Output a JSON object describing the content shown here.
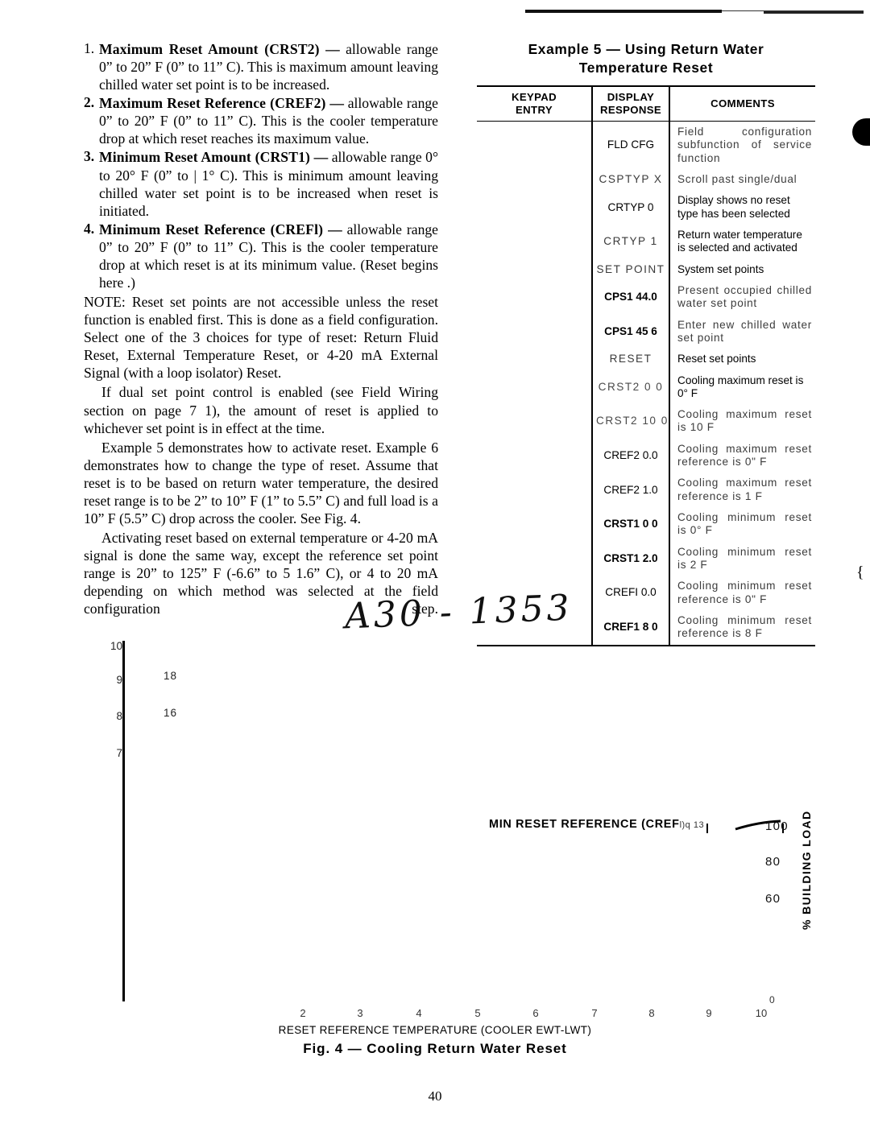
{
  "document": {
    "page_number": "40",
    "handwritten_note": "A30 - 1353"
  },
  "left_column": {
    "numbered_items": [
      {
        "number": "1.",
        "term": "Maximum Reset Amount (CRST2)",
        "dash": "—",
        "text": "allowable range 0” to 20” F (0” to 11” C). This is maximum amount leaving chilled water set point is to be increased."
      },
      {
        "number": "2.",
        "term": "Maximum Reset Reference (CREF2)",
        "dash": "—",
        "text": "allowable range 0” to 20” F (0” to 11” C). This is the cooler temperature drop at which reset reaches its maximum value."
      },
      {
        "number": "3.",
        "term": "Minimum Reset Amount (CRST1)",
        "dash": "—",
        "text": "allowable range 0° to 20° F (0” to | 1° C). This is minimum amount leaving chilled water set point is to be increased when reset is initiated."
      },
      {
        "number": "4.",
        "term": "Minimum Reset Reference (CREFl)",
        "dash": "—",
        "text": "allowable range 0” to 20” F (0” to 11” C). This is the cooler temperature drop at which reset is at its minimum value. (Reset begins here .)"
      }
    ],
    "paragraphs": [
      "NOTE: Reset set points are not accessible unless the reset function is enabled first. This is done as a field configuration. Select one of the 3 choices for type of reset: Return Fluid Reset, External Temperature Reset, or 4-20 mA External Signal (with a loop isolator) Reset.",
      "If dual set point control is enabled (see Field Wiring section on page 7 1), the amount of reset is applied to whichever set point is in effect at the time.",
      "Example 5 demonstrates how to activate reset. Example 6 demonstrates how to change the type of reset. Assume that reset is to be based on return water temperature, the desired reset range is to be 2” to 10” F (1” to 5.5” C) and full load is a 10” F (5.5” C) drop across the cooler. See Fig. 4.",
      "Activating reset based on external temperature or 4-20 mA signal is done the same way, except the reference set point range is 20” to 125” F (-6.6” to 5 1.6” C), or 4 to 20 mA depending on which method was selected at the field configuration step."
    ]
  },
  "example_table": {
    "title_line1": "Example 5 — Using Return Water",
    "title_line2": "Temperature Reset",
    "headers": [
      "KEYPAD\nENTRY",
      "DISPLAY\nRESPONSE",
      "COMMENTS"
    ],
    "header_keypad_l1": "KEYPAD",
    "header_keypad_l2": "ENTRY",
    "header_display_l1": "DISPLAY",
    "header_display_l2": "RESPONSE",
    "header_comments": "COMMENTS",
    "rows": [
      {
        "keypad": "",
        "display": "FLD CFG",
        "comment": "Field configuration subfunction of service function"
      },
      {
        "keypad": "",
        "display": "CSPTYP X",
        "comment": "Scroll past single/dual"
      },
      {
        "keypad": "",
        "display": "CRTYP 0",
        "comment": "Display shows no reset type has been selected"
      },
      {
        "keypad": "",
        "display": "CRTYP 1",
        "comment": "Return water temperature is selected and activated"
      },
      {
        "keypad": "",
        "display": "SET POINT",
        "comment": "System set points"
      },
      {
        "keypad": "",
        "display": "CPS1 44.0",
        "comment": "Present occupied chilled water set point"
      },
      {
        "keypad": "",
        "display": "CPS1 45 6",
        "comment": "Enter new chilled water set point"
      },
      {
        "keypad": "",
        "display": "RESET",
        "comment": "Reset set points"
      },
      {
        "keypad": "",
        "display": "CRST2 0 0",
        "comment": "Cooling maximum reset is 0° F"
      },
      {
        "keypad": "",
        "display": "CRST2 10 0",
        "comment": "Cooling maximum reset is 10 F"
      },
      {
        "keypad": "",
        "display": "CREF2 0.0",
        "comment": "Cooling maximum reset reference is 0\" F"
      },
      {
        "keypad": "",
        "display": "CREF2 1.0",
        "comment": "Cooling maximum reset reference is 1 F"
      },
      {
        "keypad": "",
        "display": "CRST1 0 0",
        "comment": "Cooling minimum reset is 0° F"
      },
      {
        "keypad": "",
        "display": "CRST1 2.0",
        "comment": "Cooling minimum reset is 2 F"
      },
      {
        "keypad": "",
        "display": "CREFI 0.0",
        "comment": "Cooling minimum reset reference is 0\" F"
      },
      {
        "keypad": "",
        "display": "CREF1 8 0",
        "comment": "Cooling minimum reset reference is 8 F"
      }
    ]
  },
  "figure": {
    "caption": "Fig. 4 — Cooling  Return  Water  Reset",
    "xaxis_title": "RESET  REFERENCE  TEMPERATURE  (COOLER  EWT-LWT)",
    "right_axis_title": "% BUILDING LOAD",
    "annotation": "MIN  RESET REFERENCE (CREF",
    "annotation_sub": "l)q  13",
    "y_ticks": [
      "10",
      "9",
      "8",
      "7"
    ],
    "y_ticks_secondary": [
      "18",
      "16"
    ],
    "x_ticks": [
      "2",
      "3",
      "4",
      "5",
      "6",
      "7",
      "8",
      "9",
      "10"
    ],
    "x_tick_extra": "0",
    "right_ticks": [
      "100",
      "80",
      "60"
    ]
  },
  "chart_data": {
    "type": "line",
    "title": "Fig. 4 — Cooling Return Water Reset",
    "xlabel": "RESET REFERENCE TEMPERATURE (COOLER EWT-LWT)",
    "ylabel": "",
    "y2label": "% BUILDING LOAD",
    "x": [
      2,
      3,
      4,
      5,
      6,
      7,
      8,
      9,
      10
    ],
    "xlim": [
      2,
      10
    ],
    "y_left_ticks": [
      7,
      8,
      9,
      10
    ],
    "y_left_secondary_ticks": [
      16,
      18
    ],
    "y_right_ticks": [
      60,
      80,
      100
    ],
    "grid": false,
    "legend": "none",
    "annotations": [
      {
        "text": "MIN RESET REFERENCE (CREFl)",
        "x": 2.2,
        "y": 100
      }
    ],
    "series": [
      {
        "name": "building load line",
        "x": [
          8.4,
          10.0
        ],
        "y": [
          97,
          100
        ]
      }
    ]
  }
}
